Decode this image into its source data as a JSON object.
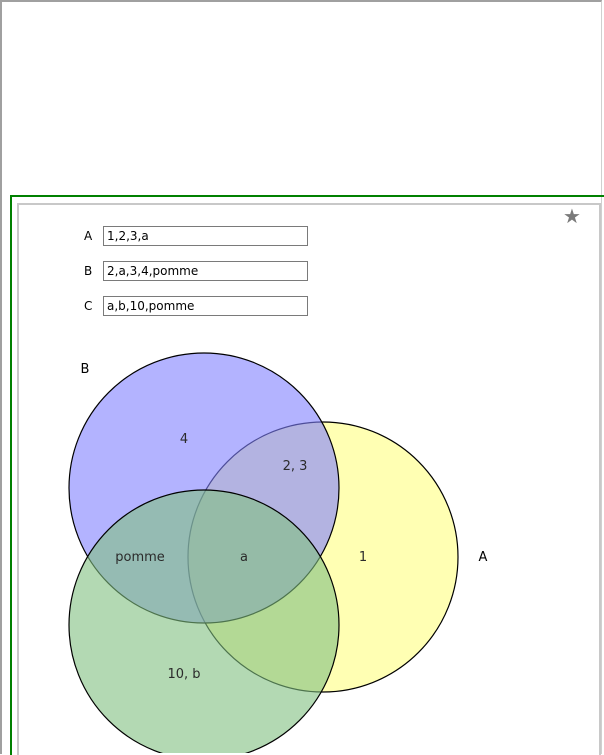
{
  "icons": {
    "favorite": "star-icon",
    "favorite_glyph": "★"
  },
  "form": {
    "rows": [
      {
        "label": "A",
        "value": "1,2,3,a"
      },
      {
        "label": "B",
        "value": "2,a,3,4,pomme"
      },
      {
        "label": "C",
        "value": "a,b,10,pomme"
      }
    ]
  },
  "venn": {
    "set_labels": {
      "A": "A",
      "B": "B"
    },
    "regions": {
      "b_only": "4",
      "a_b": "2, 3",
      "b_c": "pomme",
      "a_b_c": "a",
      "a_only": "1",
      "c_only": "10, b"
    },
    "colors": {
      "A": "#ffff80",
      "B": "#8080ff",
      "C": "#80c080"
    }
  }
}
